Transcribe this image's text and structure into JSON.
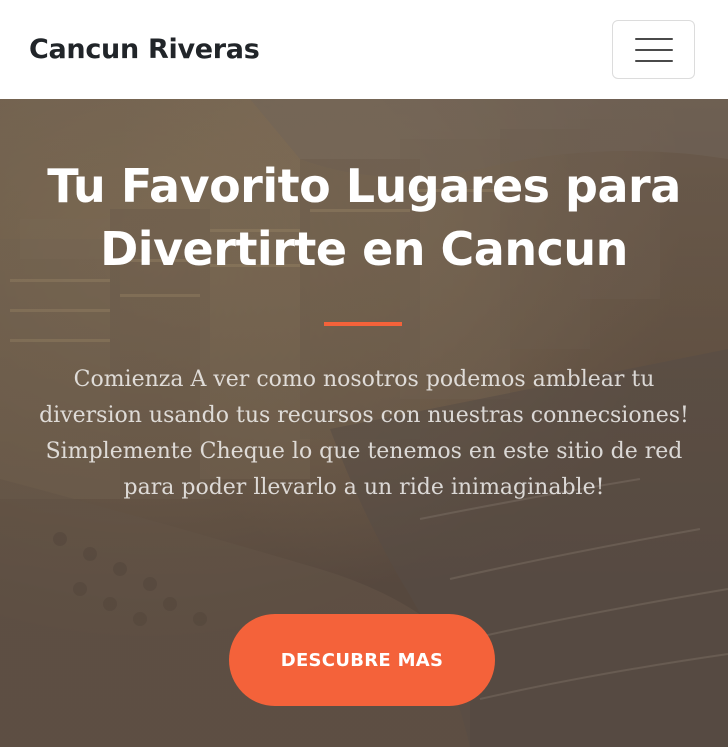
{
  "navbar": {
    "brand": "Cancun Riveras",
    "toggle_icon": "hamburger-menu-icon"
  },
  "hero": {
    "headline_line1": "Tu Favorito Lugares para",
    "headline_line2": "Divertirte en Cancun",
    "description": "Comienza A ver como nosotros podemos amblear tu diversion usando tus recursos con nuestras connecsiones! Simplemente Cheque lo que tenemos en este sitio de red para poder llevarlo a un ride inimaginable!",
    "cta_label": "DESCUBRE MAS"
  },
  "colors": {
    "accent": "#f4623a",
    "brand_text": "#212529",
    "overlay": "#5c4d42"
  }
}
